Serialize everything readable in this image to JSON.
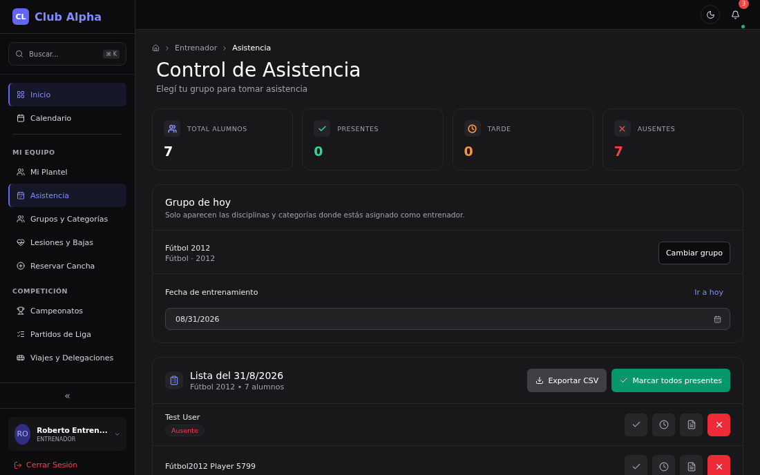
{
  "sidebar": {
    "brand": {
      "logo": "CL",
      "name": "Club Alpha"
    },
    "search": {
      "placeholder": "Buscar...",
      "shortcut": "⌘ K"
    },
    "groups": [
      {
        "items": [
          {
            "label": "Inicio",
            "selected": true
          },
          {
            "label": "Calendario",
            "selected": false
          }
        ]
      },
      {
        "title": "MI EQUIPO",
        "items": [
          {
            "label": "Mi Plantel",
            "selected": false
          },
          {
            "label": "Asistencia",
            "selected": true
          },
          {
            "label": "Grupos y Categorías",
            "selected": false
          },
          {
            "label": "Lesiones y Bajas",
            "selected": false
          },
          {
            "label": "Reservar Cancha",
            "selected": false
          }
        ]
      },
      {
        "title": "COMPETICIÓN",
        "items": [
          {
            "label": "Campeonatos",
            "selected": false
          },
          {
            "label": "Partidos de Liga",
            "selected": false
          },
          {
            "label": "Viajes y Delegaciones",
            "selected": false
          }
        ]
      }
    ],
    "collapse": "«",
    "user": {
      "initials": "RO",
      "name": "Roberto Entren...",
      "role": "ENTRENADOR"
    },
    "logout": "Cerrar Sesión"
  },
  "topbar": {
    "notifications": "3"
  },
  "breadcrumb": [
    "Entrenador",
    "Asistencia"
  ],
  "title": "Control de Asistencia",
  "subtitle": "Elegí tu grupo para tomar asistencia",
  "stats": [
    {
      "label": "TOTAL ALUMNOS",
      "value": "7",
      "color": "#818cf8"
    },
    {
      "label": "PRESENTES",
      "value": "0",
      "color": "#34d399"
    },
    {
      "label": "TARDE",
      "value": "0",
      "color": "#fb923c"
    },
    {
      "label": "AUSENTES",
      "value": "7",
      "color": "#ef4444"
    }
  ],
  "group_card": {
    "title": "Grupo de hoy",
    "description": "Solo aparecen las disciplinas y categorías donde estás asignado como entrenador.",
    "group_name": "Fútbol 2012",
    "group_detail": "Fútbol · 2012",
    "change_button": "Cambiar grupo",
    "date_label": "Fecha de entrenamiento",
    "today_link": "Ir a hoy",
    "date": {
      "value": "08/31/2026"
    }
  },
  "list": {
    "title": "Lista del 31/8/2026",
    "subtitle": "Fútbol 2012 • 7 alumnos",
    "export_button": "Exportar CSV",
    "mark_all_button": "Marcar todos presentes",
    "rows": [
      {
        "name": "Test User",
        "status": "Ausente",
        "actions": [
          {
            "selected": false
          },
          {
            "selected": false
          },
          {
            "selected": false
          },
          {
            "selected": true
          }
        ]
      },
      {
        "name": "Fútbol2012 Player 5799",
        "actions": [
          {
            "selected": false
          },
          {
            "selected": false
          },
          {
            "selected": false
          },
          {
            "selected": true
          }
        ]
      }
    ]
  }
}
